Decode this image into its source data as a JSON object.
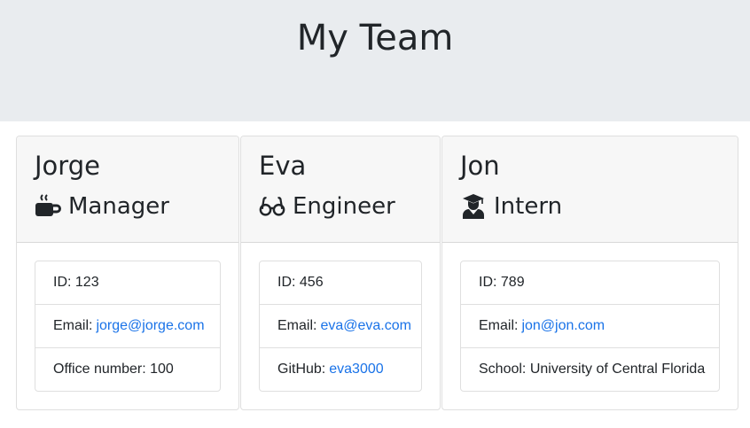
{
  "header": {
    "title": "My Team"
  },
  "team": [
    {
      "name": "Jorge",
      "role": "Manager",
      "icon": "coffee-mug-icon",
      "id_label": "ID: 123",
      "email_prefix": "Email:",
      "email": "jorge@jorge.com",
      "extra_text": "Office number: 100"
    },
    {
      "name": "Eva",
      "role": "Engineer",
      "icon": "glasses-icon",
      "id_label": "ID: 456",
      "email_prefix": "Email:",
      "email": "eva@eva.com",
      "github_prefix": "GitHub:",
      "github": "eva3000"
    },
    {
      "name": "Jon",
      "role": "Intern",
      "icon": "graduate-icon",
      "id_label": "ID: 789",
      "email_prefix": "Email:",
      "email": "jon@jon.com",
      "extra_text": "School: University of Central Florida"
    }
  ],
  "colors": {
    "header_bg": "#e9ecef",
    "card_header_bg": "#f7f7f7",
    "link": "#1a73e8",
    "text": "#212529"
  }
}
